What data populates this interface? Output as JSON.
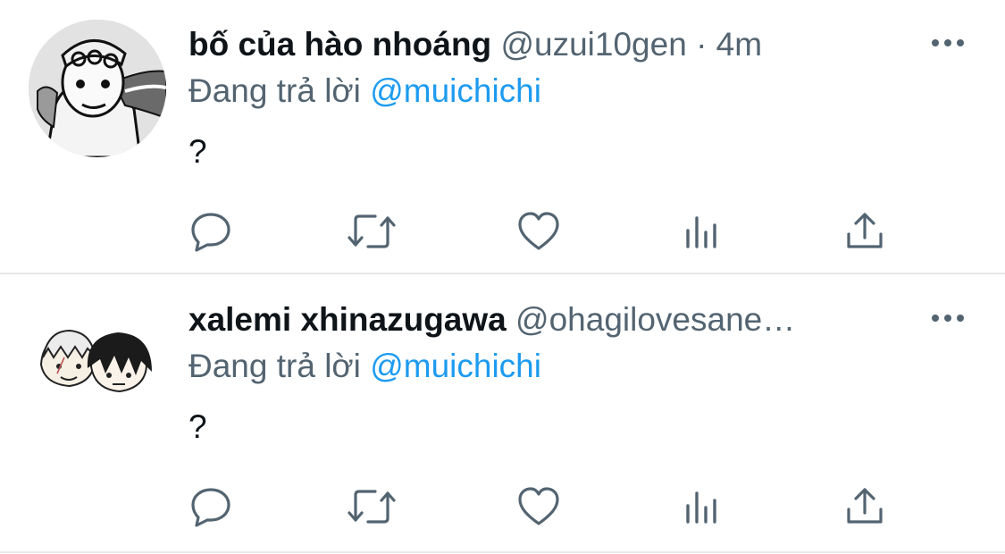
{
  "tweets": [
    {
      "display_name": "bố của hào nhoáng",
      "handle": "@uzui10gen",
      "separator": "·",
      "time": "4m",
      "reply_prefix": "Đang trả lời",
      "reply_to": "@muichichi",
      "text": "?"
    },
    {
      "display_name": "xalemi xhinazugawa",
      "handle": "@ohagilovesane…",
      "separator": "",
      "time": "",
      "reply_prefix": "Đang trả lời",
      "reply_to": "@muichichi",
      "text": "?"
    }
  ],
  "icons": {
    "more": "more-horizontal-icon",
    "reply": "reply-bubble-icon",
    "retweet": "retweet-icon",
    "like": "heart-icon",
    "views": "views-bar-chart-icon",
    "share": "share-upload-icon"
  },
  "colors": {
    "text": "#0f1419",
    "secondary": "#536471",
    "link": "#1d9bf0",
    "divider": "#e6e8ea"
  }
}
